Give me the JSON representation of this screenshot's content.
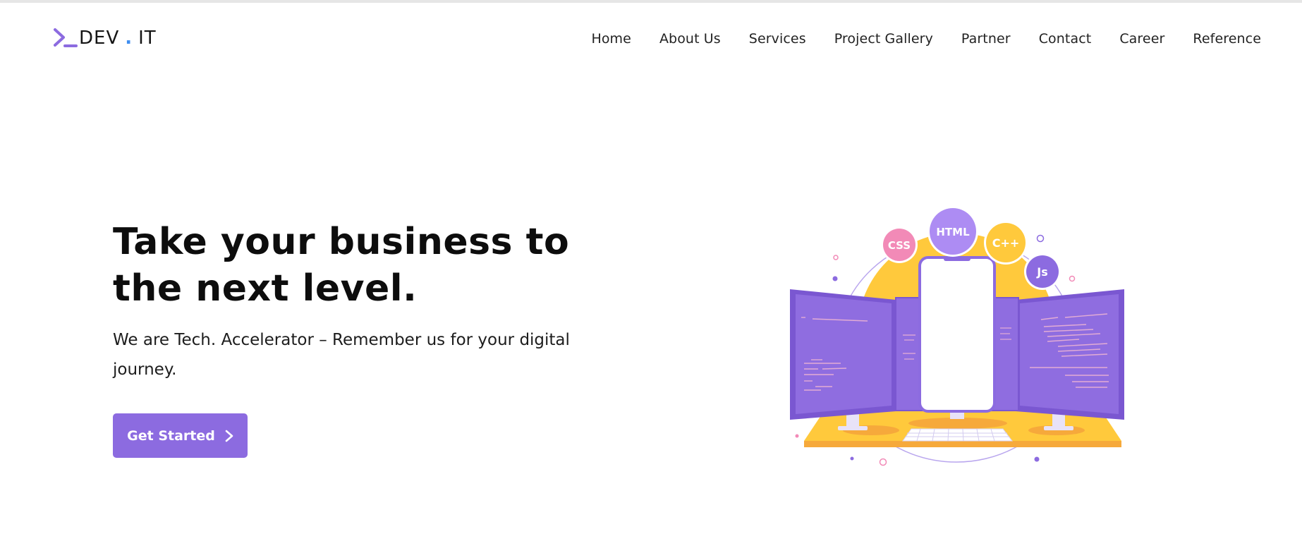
{
  "header": {
    "logo": {
      "prefix": "DEV",
      "dot": ".",
      "suffix": "IT"
    },
    "nav": [
      {
        "label": "Home"
      },
      {
        "label": "About Us"
      },
      {
        "label": "Services"
      },
      {
        "label": "Project Gallery"
      },
      {
        "label": "Partner"
      },
      {
        "label": "Contact"
      },
      {
        "label": "Career"
      },
      {
        "label": "Reference"
      }
    ]
  },
  "hero": {
    "title": "Take your business to the next level.",
    "subtitle": "We are Tech. Accelerator – Remember us for your digital journey.",
    "cta_label": "Get Started",
    "cta_icon": "chevron-right-icon"
  },
  "illustration": {
    "badges": [
      {
        "label": "CSS",
        "color": "#f28ab7"
      },
      {
        "label": "HTML",
        "color": "#ad8cf3"
      },
      {
        "label": "C++",
        "color": "#ffc93c"
      },
      {
        "label": "Js",
        "color": "#8c6be0"
      }
    ]
  },
  "colors": {
    "accent": "#8c6be0",
    "yellow": "#ffc93c",
    "logo_dot": "#3f8ef0"
  }
}
